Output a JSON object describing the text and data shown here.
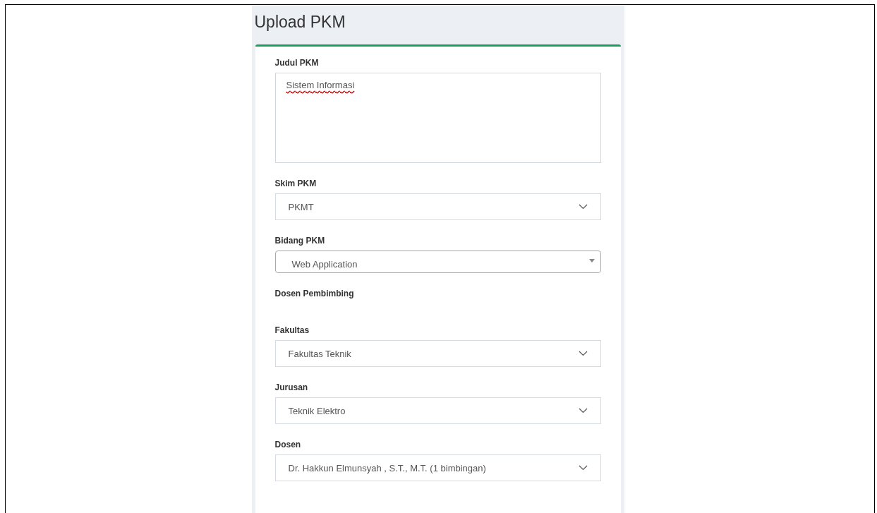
{
  "page_title": "Upload PKM",
  "fields": [
    {
      "kind": "textarea",
      "label": "Judul PKM",
      "value": "Sistem Informasi",
      "spellcheck_error": true
    },
    {
      "kind": "select",
      "label": "Skim PKM",
      "value": "PKMT"
    },
    {
      "kind": "select2",
      "label": "Bidang PKM",
      "value": "Web Application"
    },
    {
      "kind": "heading",
      "label": "Dosen Pembimbing"
    },
    {
      "kind": "select",
      "label": "Fakultas",
      "value": "Fakultas Teknik"
    },
    {
      "kind": "select",
      "label": "Jurusan",
      "value": "Teknik Elektro"
    },
    {
      "kind": "select",
      "label": "Dosen",
      "value": "Dr. Hakkun Elmunsyah , S.T., M.T. (1 bimbingan)"
    }
  ]
}
